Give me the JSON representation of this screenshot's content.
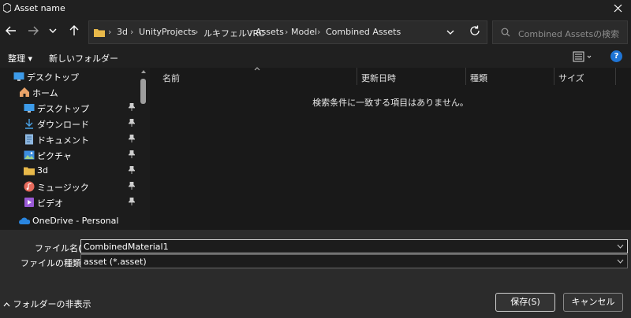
{
  "window": {
    "title": "Asset name"
  },
  "address": {
    "segments": [
      "3d",
      "UnityProjects",
      "ルキフェルVRC",
      "Assets",
      "Model",
      "Combined Assets"
    ]
  },
  "search": {
    "placeholder": "Combined Assetsの検索"
  },
  "toolbar": {
    "organize_label": "整理 ▾",
    "new_folder_label": "新しいフォルダー",
    "help_label": "?"
  },
  "sidebar": {
    "items": [
      {
        "label": "デスクトップ",
        "icon": "desktop-icon"
      },
      {
        "label": "ホーム",
        "icon": "home-icon"
      },
      {
        "label": "デスクトップ",
        "icon": "desktop-icon",
        "pinned": true
      },
      {
        "label": "ダウンロード",
        "icon": "download-icon",
        "pinned": true
      },
      {
        "label": "ドキュメント",
        "icon": "document-icon",
        "pinned": true
      },
      {
        "label": "ピクチャ",
        "icon": "pictures-icon",
        "pinned": true
      },
      {
        "label": "3d",
        "icon": "folder-icon",
        "pinned": true
      },
      {
        "label": "ミュージック",
        "icon": "music-icon",
        "pinned": true
      },
      {
        "label": "ビデオ",
        "icon": "video-icon",
        "pinned": true
      },
      {
        "label": "OneDrive - Personal",
        "icon": "onedrive-icon"
      }
    ]
  },
  "filelist": {
    "columns": [
      "名前",
      "更新日時",
      "種類",
      "サイズ"
    ],
    "empty_message": "検索条件に一致する項目はありません。"
  },
  "form": {
    "filename_label": "ファイル名(N):",
    "filename_value": "CombinedMaterial1",
    "filetype_label": "ファイルの種類(T):",
    "filetype_value": "asset (*.asset)"
  },
  "buttons": {
    "save_label": "保存(S)",
    "cancel_label": "キャンセル"
  },
  "footer": {
    "hide_folders_label": "フォルダーの非表示"
  },
  "colors": {
    "accent": "#1f75d6",
    "folder": "#e8b94a",
    "background": "#1c1c1c"
  }
}
